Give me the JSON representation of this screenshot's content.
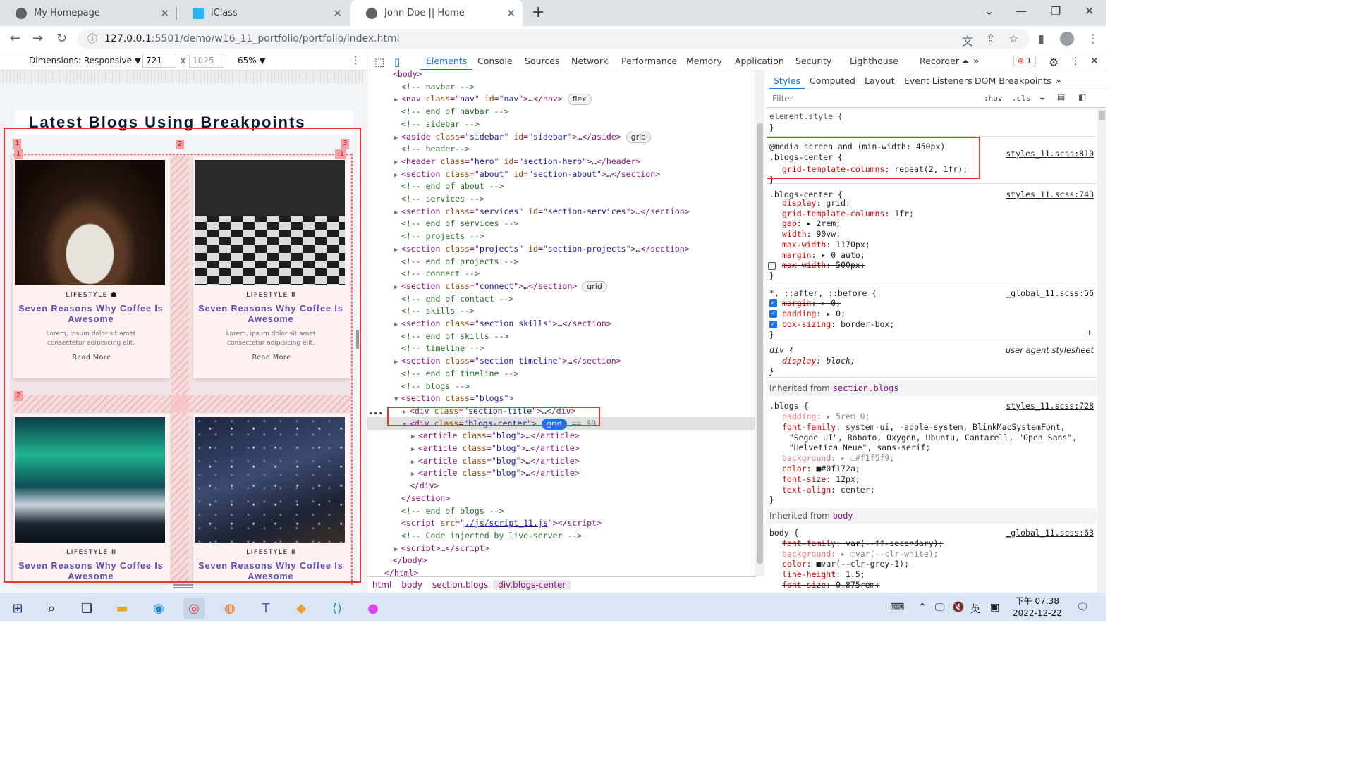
{
  "browser": {
    "tabs": [
      {
        "title": "My Homepage",
        "icon": "globe-icon"
      },
      {
        "title": "iClass",
        "icon": "iclass-icon"
      },
      {
        "title": "John Doe || Home",
        "icon": "globe-icon"
      }
    ],
    "url_host": "127.0.0.1",
    "url_path": ":5501/demo/w16_11_portfolio/portfolio/index.html"
  },
  "device_toolbar": {
    "dimensions_label": "Dimensions: Responsive ▼",
    "width": "721",
    "height": "1025",
    "times": "x",
    "zoom": "65% ▼"
  },
  "page": {
    "heading": "Latest Blogs Using Breakpoints",
    "grid_numbers": {
      "top1": "1",
      "top2": "2",
      "top3": "3",
      "left1": "1",
      "neg1": "-1",
      "left2": "2"
    },
    "cards": [
      {
        "category": "LIFESTYLE ☗",
        "title": "Seven Reasons Why Coffee Is Awesome",
        "desc": "Lorem, ipsum dolor sit amet consectetur adipisicing elit.",
        "more": "Read More",
        "image": "coffee"
      },
      {
        "category": "LIFESTYLE Ⅲ",
        "title": "Seven Reasons Why Coffee Is Awesome",
        "desc": "Lorem, ipsum dolor sit amet consectetur adipisicing elit.",
        "more": "Read More",
        "image": "chess"
      },
      {
        "category": "LIFESTYLE Ⅲ",
        "title": "Seven Reasons Why Coffee Is Awesome",
        "desc": "",
        "more": "",
        "image": "aurora"
      },
      {
        "category": "LIFESTYLE Ⅲ",
        "title": "Seven Reasons Why Coffee Is Awesome",
        "desc": "",
        "more": "",
        "image": "stars"
      }
    ]
  },
  "devtools": {
    "tabs": [
      "Elements",
      "Console",
      "Sources",
      "Network",
      "Performance",
      "Memory",
      "Application",
      "Security",
      "Lighthouse",
      "Recorder ⏶"
    ],
    "error_count": "1",
    "dom_lines": [
      {
        "ind": 1,
        "arrow": "",
        "html": "<span class='tg'>&lt;body&gt;</span>"
      },
      {
        "ind": 2,
        "arrow": "",
        "html": "<span class='cm'>&lt;!-- navbar --&gt;</span>"
      },
      {
        "ind": 2,
        "arrow": "▶",
        "html": "<span class='tg'>&lt;nav</span> <span class='an'>class</span><span class='tg'>=\"</span><span class='av'>nav</span><span class='tg'>\"</span> <span class='an'>id</span><span class='tg'>=\"</span><span class='av'>nav</span><span class='tg'>\"&gt;</span>…<span class='tg'>&lt;/nav&gt;</span> <span class='badge'>flex</span>"
      },
      {
        "ind": 2,
        "arrow": "",
        "html": "<span class='cm'>&lt;!-- end of navbar --&gt;</span>"
      },
      {
        "ind": 2,
        "arrow": "",
        "html": "<span class='cm'>&lt;!-- sidebar --&gt;</span>"
      },
      {
        "ind": 2,
        "arrow": "▶",
        "html": "<span class='tg'>&lt;aside</span> <span class='an'>class</span><span class='tg'>=\"</span><span class='av'>sidebar</span><span class='tg'>\"</span> <span class='an'>id</span><span class='tg'>=\"</span><span class='av'>sidebar</span><span class='tg'>\"&gt;</span>…<span class='tg'>&lt;/aside&gt;</span> <span class='badge'>grid</span>"
      },
      {
        "ind": 2,
        "arrow": "",
        "html": "<span class='cm'>&lt;!-- header--&gt;</span>"
      },
      {
        "ind": 2,
        "arrow": "▶",
        "html": "<span class='tg'>&lt;header</span> <span class='an'>class</span><span class='tg'>=\"</span><span class='av'>hero</span><span class='tg'>\"</span> <span class='an'>id</span><span class='tg'>=\"</span><span class='av'>section-hero</span><span class='tg'>\"&gt;</span>…<span class='tg'>&lt;/header&gt;</span>"
      },
      {
        "ind": 2,
        "arrow": "▶",
        "html": "<span class='tg'>&lt;section</span> <span class='an'>class</span><span class='tg'>=\"</span><span class='av'>about</span><span class='tg'>\"</span> <span class='an'>id</span><span class='tg'>=\"</span><span class='av'>section-about</span><span class='tg'>\"&gt;</span>…<span class='tg'>&lt;/section&gt;</span>"
      },
      {
        "ind": 2,
        "arrow": "",
        "html": "<span class='cm'>&lt;!-- end of about --&gt;</span>"
      },
      {
        "ind": 2,
        "arrow": "",
        "html": "<span class='cm'>&lt;!-- services --&gt;</span>"
      },
      {
        "ind": 2,
        "arrow": "▶",
        "html": "<span class='tg'>&lt;section</span> <span class='an'>class</span><span class='tg'>=\"</span><span class='av'>services</span><span class='tg'>\"</span> <span class='an'>id</span><span class='tg'>=\"</span><span class='av'>section-services</span><span class='tg'>\"&gt;</span>…<span class='tg'>&lt;/section&gt;</span>"
      },
      {
        "ind": 2,
        "arrow": "",
        "html": "<span class='cm'>&lt;!-- end of services --&gt;</span>"
      },
      {
        "ind": 2,
        "arrow": "",
        "html": "<span class='cm'>&lt;!-- projects --&gt;</span>"
      },
      {
        "ind": 2,
        "arrow": "▶",
        "html": "<span class='tg'>&lt;section</span> <span class='an'>class</span><span class='tg'>=\"</span><span class='av'>projects</span><span class='tg'>\"</span> <span class='an'>id</span><span class='tg'>=\"</span><span class='av'>section-projects</span><span class='tg'>\"&gt;</span>…<span class='tg'>&lt;/section&gt;</span>"
      },
      {
        "ind": 2,
        "arrow": "",
        "html": "<span class='cm'>&lt;!-- end of projects --&gt;</span>"
      },
      {
        "ind": 2,
        "arrow": "",
        "html": "<span class='cm'>&lt;!-- connect --&gt;</span>"
      },
      {
        "ind": 2,
        "arrow": "▶",
        "html": "<span class='tg'>&lt;section</span> <span class='an'>class</span><span class='tg'>=\"</span><span class='av'>connect</span><span class='tg'>\"&gt;</span>…<span class='tg'>&lt;/section&gt;</span> <span class='badge'>grid</span>"
      },
      {
        "ind": 2,
        "arrow": "",
        "html": "<span class='cm'>&lt;!-- end of contact --&gt;</span>"
      },
      {
        "ind": 2,
        "arrow": "",
        "html": "<span class='cm'>&lt;!-- skills --&gt;</span>"
      },
      {
        "ind": 2,
        "arrow": "▶",
        "html": "<span class='tg'>&lt;section</span> <span class='an'>class</span><span class='tg'>=\"</span><span class='av'>section skills</span><span class='tg'>\"&gt;</span>…<span class='tg'>&lt;/section&gt;</span>"
      },
      {
        "ind": 2,
        "arrow": "",
        "html": "<span class='cm'>&lt;!-- end of skills --&gt;</span>"
      },
      {
        "ind": 2,
        "arrow": "",
        "html": "<span class='cm'>&lt;!-- timeline --&gt;</span>"
      },
      {
        "ind": 2,
        "arrow": "▶",
        "html": "<span class='tg'>&lt;section</span> <span class='an'>class</span><span class='tg'>=\"</span><span class='av'>section timeline</span><span class='tg'>\"&gt;</span>…<span class='tg'>&lt;/section&gt;</span>"
      },
      {
        "ind": 2,
        "arrow": "",
        "html": "<span class='cm'>&lt;!-- end of timeline --&gt;</span>"
      },
      {
        "ind": 2,
        "arrow": "",
        "html": "<span class='cm'>&lt;!-- blogs --&gt;</span>"
      },
      {
        "ind": 2,
        "arrow": "▼",
        "html": "<span class='tg'>&lt;section</span> <span class='an'>class</span><span class='tg'>=\"</span><span class='av'>blogs</span><span class='tg'>\"&gt;</span>"
      },
      {
        "ind": 3,
        "arrow": "▶",
        "html": "<span class='tg'>&lt;div</span> <span class='an'>class</span><span class='tg'>=\"</span><span class='av'>section-title</span><span class='tg'>\"&gt;</span>…<span class='tg'>&lt;/div&gt;</span>"
      },
      {
        "ind": 3,
        "arrow": "▼",
        "sel": true,
        "html": "<span class='tg'>&lt;div</span> <span class='an'>class</span><span class='tg'>=\"</span><span class='av'>blogs-center</span><span class='tg'>\"&gt;</span> <span class='badge sel'>grid</span> <span style='color:#777'>== $0</span>"
      },
      {
        "ind": 4,
        "arrow": "▶",
        "html": "<span class='tg'>&lt;article</span> <span class='an'>class</span><span class='tg'>=\"</span><span class='av'>blog</span><span class='tg'>\"&gt;</span>…<span class='tg'>&lt;/article&gt;</span>"
      },
      {
        "ind": 4,
        "arrow": "▶",
        "html": "<span class='tg'>&lt;article</span> <span class='an'>class</span><span class='tg'>=\"</span><span class='av'>blog</span><span class='tg'>\"&gt;</span>…<span class='tg'>&lt;/article&gt;</span>"
      },
      {
        "ind": 4,
        "arrow": "▶",
        "html": "<span class='tg'>&lt;article</span> <span class='an'>class</span><span class='tg'>=\"</span><span class='av'>blog</span><span class='tg'>\"&gt;</span>…<span class='tg'>&lt;/article&gt;</span>"
      },
      {
        "ind": 4,
        "arrow": "▶",
        "html": "<span class='tg'>&lt;article</span> <span class='an'>class</span><span class='tg'>=\"</span><span class='av'>blog</span><span class='tg'>\"&gt;</span>…<span class='tg'>&lt;/article&gt;</span>"
      },
      {
        "ind": 3,
        "arrow": "",
        "html": "<span class='tg'>&lt;/div&gt;</span>"
      },
      {
        "ind": 2,
        "arrow": "",
        "html": "<span class='tg'>&lt;/section&gt;</span>"
      },
      {
        "ind": 2,
        "arrow": "",
        "html": "<span class='cm'>&lt;!-- end of blogs --&gt;</span>"
      },
      {
        "ind": 2,
        "arrow": "",
        "html": "<span class='tg'>&lt;script</span> <span class='an'>src</span><span class='tg'>=\"</span><span class='av' style='text-decoration:underline'>./js/script_11.js</span><span class='tg'>\"&gt;&lt;/script&gt;</span>"
      },
      {
        "ind": 2,
        "arrow": "",
        "html": "<span class='cm'>&lt;!-- Code injected by live-server --&gt;</span>"
      },
      {
        "ind": 2,
        "arrow": "▶",
        "html": "<span class='tg'>&lt;script&gt;</span>…<span class='tg'>&lt;/script&gt;</span>"
      },
      {
        "ind": 1,
        "arrow": "",
        "html": "<span class='tg'>&lt;/body&gt;</span>"
      },
      {
        "ind": 0,
        "arrow": "",
        "html": "<span class='tg'>&lt;/html&gt;</span>"
      }
    ],
    "breadcrumbs": [
      "html",
      "body",
      "section.blogs",
      "div.blogs-center"
    ],
    "styles_tabs": [
      "Styles",
      "Computed",
      "Layout",
      "Event Listeners",
      "DOM Breakpoints"
    ],
    "filter_placeholder": "Filter",
    "filter_tools": ":hov  .cls  +",
    "element_style": "element.style {",
    "media_rule": {
      "media": "@media screen and (min-width: 450px)",
      "selector": ".blogs-center {",
      "prop": "grid-template-columns",
      "value": "repeat(2, 1fr);",
      "source": "styles_11.scss:810"
    },
    "blogs_center_rule": {
      "selector": ".blogs-center {",
      "source": "styles_11.scss:743",
      "lines": [
        {
          "p": "display",
          "v": "grid;",
          "s": false
        },
        {
          "p": "grid-template-columns",
          "v": "1fr;",
          "s": true
        },
        {
          "p": "gap",
          "v": "▸ 2rem;",
          "s": false
        },
        {
          "p": "width",
          "v": "90vw;",
          "s": false
        },
        {
          "p": "max-width",
          "v": "1170px;",
          "s": false
        },
        {
          "p": "margin",
          "v": "▸ 0 auto;",
          "s": false
        },
        {
          "p": "max-width",
          "v": "500px;",
          "s": true
        }
      ]
    },
    "universal_rule": {
      "selector": "*, ::after, ::before {",
      "source": "_global_11.scss:56",
      "lines": [
        {
          "p": "margin",
          "v": "▸ 0;",
          "s": true
        },
        {
          "p": "padding",
          "v": "▸ 0;",
          "s": false
        },
        {
          "p": "box-sizing",
          "v": "border-box;",
          "s": false
        }
      ]
    },
    "div_rule": {
      "selector": "div {",
      "source": "user agent stylesheet",
      "p": "display",
      "v": "block;"
    },
    "inherited_blogs": "section.blogs",
    "inherited_from_label": "Inherited from",
    "blogs_rule": {
      "selector": ".blogs {",
      "source": "styles_11.scss:728",
      "lines": [
        {
          "p": "padding",
          "v": "▸ 5rem 0;",
          "d": true
        },
        {
          "p": "font-family",
          "v": "system-ui, -apple-system, BlinkMacSystemFont,",
          "d": false
        },
        {
          "p": "",
          "v": "    \"Segoe UI\", Roboto, Oxygen, Ubuntu, Cantarell, \"Open Sans\",",
          "d": false
        },
        {
          "p": "",
          "v": "    \"Helvetica Neue\", sans-serif;",
          "d": false
        },
        {
          "p": "background",
          "v": "▸ ☐#f1f5f9;",
          "d": true
        },
        {
          "p": "color",
          "v": "■#0f172a;",
          "d": false
        },
        {
          "p": "font-size",
          "v": "12px;",
          "d": false
        },
        {
          "p": "text-align",
          "v": "center;",
          "d": false
        }
      ]
    },
    "inherited_body": "body",
    "body_rule": {
      "selector": "body {",
      "source": "_global_11.scss:63",
      "lines": [
        {
          "p": "font-family",
          "v": "var(--ff-secondary);",
          "s": true
        },
        {
          "p": "background",
          "v": "▸ ☐var(--clr-white);",
          "s": false,
          "d": true
        },
        {
          "p": "color",
          "v": "■var(--clr-grey-1);",
          "s": true
        },
        {
          "p": "line-height",
          "v": "1.5;",
          "s": false
        },
        {
          "p": "font-size",
          "v": "0.875rem;",
          "s": true
        }
      ]
    }
  },
  "taskbar": {
    "time": "下午 07:38",
    "date": "2022-12-22",
    "ime": "英"
  }
}
